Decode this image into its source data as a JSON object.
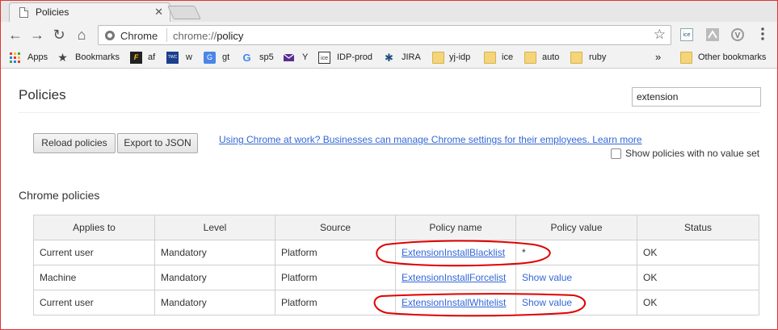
{
  "tab": {
    "title": "Policies",
    "close": "✕"
  },
  "omnibox": {
    "origin": "Chrome",
    "url_scheme": "chrome://",
    "url_path": "policy"
  },
  "toolbar": {
    "back": "←",
    "forward": "→",
    "reload": "↻",
    "home": "⌂",
    "star": "☆",
    "ext_ice": "ice",
    "ext_v": "V"
  },
  "bookmarks": {
    "apps": "Apps",
    "items": [
      {
        "label": "Bookmarks"
      },
      {
        "label": "af"
      },
      {
        "label": "w"
      },
      {
        "label": "gt"
      },
      {
        "label": "sp5"
      },
      {
        "label": "Y"
      },
      {
        "label": "IDP-prod"
      },
      {
        "label": "JIRA"
      },
      {
        "label": "yj-idp"
      },
      {
        "label": "ice"
      },
      {
        "label": "auto"
      },
      {
        "label": "ruby"
      }
    ],
    "overflow": "»",
    "other": "Other bookmarks"
  },
  "page": {
    "title": "Policies",
    "search_value": "extension",
    "reload_button": "Reload policies",
    "export_button": "Export to JSON",
    "learn_more": "Using Chrome at work? Businesses can manage Chrome settings for their employees. Learn more",
    "show_no_value_label": "Show policies with no value set",
    "section_title": "Chrome policies"
  },
  "table": {
    "headers": [
      "Applies to",
      "Level",
      "Source",
      "Policy name",
      "Policy value",
      "Status"
    ],
    "rows": [
      {
        "applies": "Current user",
        "level": "Mandatory",
        "source": "Platform",
        "name": "ExtensionInstallBlacklist",
        "value": "*",
        "status": "OK"
      },
      {
        "applies": "Machine",
        "level": "Mandatory",
        "source": "Platform",
        "name": "ExtensionInstallForcelist",
        "value": "Show value",
        "status": "OK"
      },
      {
        "applies": "Current user",
        "level": "Mandatory",
        "source": "Platform",
        "name": "ExtensionInstallWhitelist",
        "value": "Show value",
        "status": "OK"
      }
    ]
  },
  "colors": {
    "link": "#3367d6",
    "annotation": "#e00000",
    "border_accent": "#dd3333"
  }
}
